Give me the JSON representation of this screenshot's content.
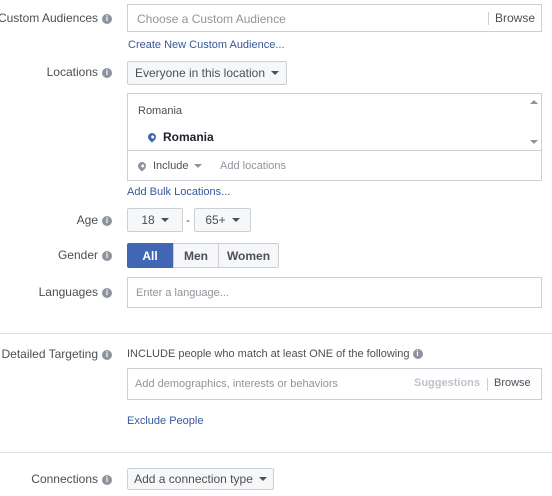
{
  "custom_audiences": {
    "label": "Custom Audiences",
    "placeholder": "Choose a Custom Audience",
    "browse": "Browse",
    "create_link": "Create New Custom Audience..."
  },
  "locations": {
    "label": "Locations",
    "dropdown": "Everyone in this location",
    "group_title": "Romania",
    "selected": "Romania",
    "include": "Include",
    "add_placeholder": "Add locations",
    "bulk_link": "Add Bulk Locations..."
  },
  "age": {
    "label": "Age",
    "min": "18",
    "dash": "-",
    "max": "65+"
  },
  "gender": {
    "label": "Gender",
    "options": [
      "All",
      "Men",
      "Women"
    ],
    "selected": "All"
  },
  "languages": {
    "label": "Languages",
    "placeholder": "Enter a language..."
  },
  "detailed_targeting": {
    "label": "Detailed Targeting",
    "description": "INCLUDE people who match at least ONE of the following",
    "placeholder": "Add demographics, interests or behaviors",
    "suggestions": "Suggestions",
    "browse": "Browse",
    "exclude_link": "Exclude People"
  },
  "connections": {
    "label": "Connections",
    "dropdown": "Add a connection type"
  },
  "colors": {
    "link": "#365899",
    "selected_bg": "#4267b2",
    "border": "#ccd0d5"
  }
}
